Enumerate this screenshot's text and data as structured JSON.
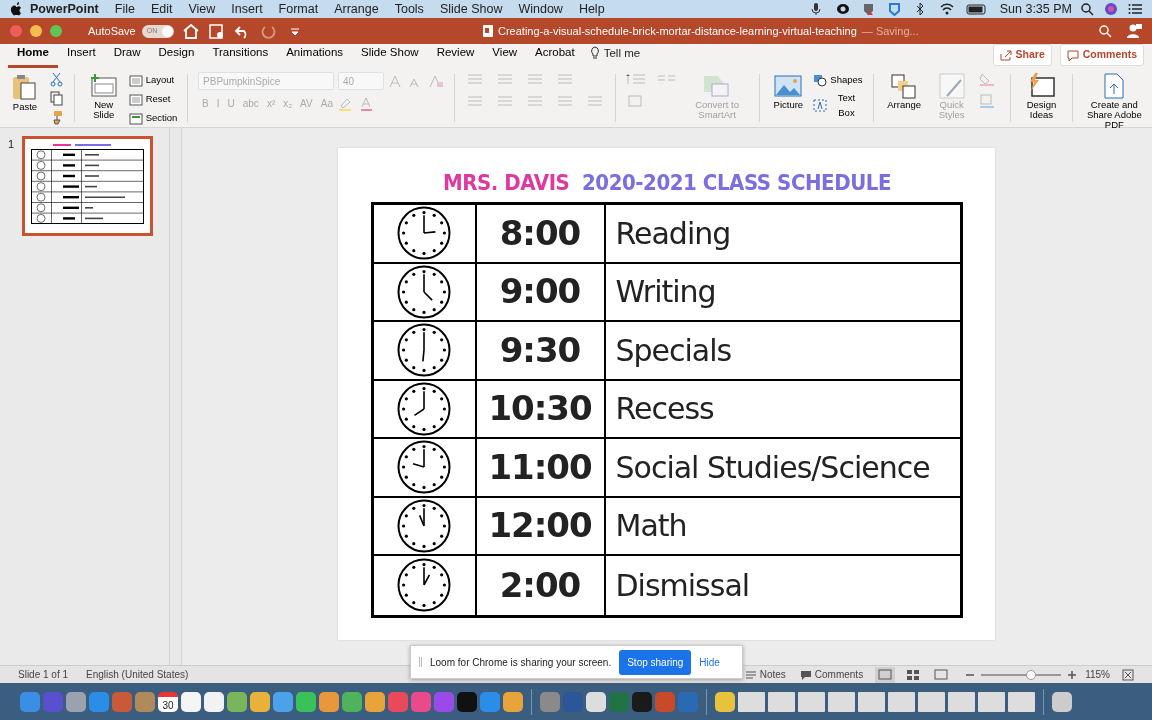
{
  "menubar": {
    "app": "PowerPoint",
    "items": [
      "File",
      "Edit",
      "View",
      "Insert",
      "Format",
      "Arrange",
      "Tools",
      "Slide Show",
      "Window",
      "Help"
    ],
    "clock": "Sun 3:35 PM"
  },
  "titlebar": {
    "autosave": "AutoSave",
    "autosave_toggle": {
      "label": "ON",
      "on": true
    },
    "document": "Creating-a-visual-schedule-brick-mortar-distance-learning-virtual-teaching",
    "status": "— Saving..."
  },
  "ribbon": {
    "tabs": [
      {
        "label": "Home",
        "selected": true
      },
      {
        "label": "Insert",
        "selected": false
      },
      {
        "label": "Draw",
        "selected": false
      },
      {
        "label": "Design",
        "selected": false
      },
      {
        "label": "Transitions",
        "selected": false
      },
      {
        "label": "Animations",
        "selected": false
      },
      {
        "label": "Slide Show",
        "selected": false
      },
      {
        "label": "Review",
        "selected": false
      },
      {
        "label": "View",
        "selected": false
      },
      {
        "label": "Acrobat",
        "selected": false
      }
    ],
    "tell_me": "Tell me",
    "share": "Share",
    "comments": "Comments",
    "paste": "Paste",
    "new_slide": "New Slide",
    "slide_items": [
      "Layout",
      "Reset",
      "Section"
    ],
    "font_name": {
      "placeholder": "PBPumpkinSpice",
      "disabled": true
    },
    "font_size": {
      "placeholder": "40",
      "disabled": true
    },
    "format_buttons": [
      "B",
      "I",
      "U",
      "abc",
      "x²",
      "x₂",
      "AV",
      "Aa"
    ],
    "large_buttons": [
      {
        "label": "Convert to SmartArt",
        "disabled": true
      },
      {
        "label": "Picture",
        "disabled": false
      }
    ],
    "insert_items": [
      "Shapes",
      "Text Box"
    ],
    "arrange_buttons": [
      {
        "label": "Arrange",
        "disabled": false
      },
      {
        "label": "Quick Styles",
        "disabled": true
      }
    ],
    "end_buttons": [
      {
        "label": "Design Ideas",
        "disabled": false
      },
      {
        "label": "Create and Share Adobe PDF",
        "disabled": false
      }
    ]
  },
  "thumbnail": {
    "number": "1",
    "selected": true
  },
  "slide": {
    "title": [
      {
        "text": "MRS. DAVIS",
        "color": "#e0399e"
      },
      {
        "text": "2020-2021 CLASS SCHEDULE",
        "color": "#7b6ee0"
      }
    ],
    "rows": [
      {
        "time": "8:00",
        "activity": "Reading"
      },
      {
        "time": "9:00",
        "activity": "Writing"
      },
      {
        "time": "9:30",
        "activity": "Specials"
      },
      {
        "time": "10:30",
        "activity": "Recess"
      },
      {
        "time": "11:00",
        "activity": "Social Studies/Science"
      },
      {
        "time": "12:00",
        "activity": "Math"
      },
      {
        "time": "2:00",
        "activity": "Dismissal"
      }
    ]
  },
  "status_bar": {
    "slide": "Slide 1 of 1",
    "language": "English (United States)",
    "notes": "Notes",
    "comments": "Comments",
    "zoom": "115%",
    "zoom_slider": {
      "level": 0.62
    }
  },
  "sharing_bar": {
    "message": "Loom for Chrome is sharing your screen.",
    "stop": "Stop sharing",
    "hide": "Hide"
  },
  "dock": {
    "calendar_day": "30"
  }
}
